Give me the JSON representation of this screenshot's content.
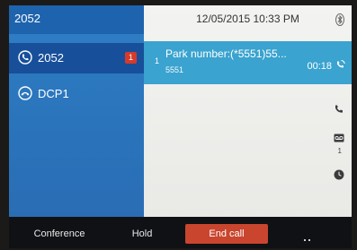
{
  "line_panel": {
    "header_label": "2052",
    "lines": [
      {
        "label": "2052",
        "badge": "1",
        "icon": "phone-active-icon"
      },
      {
        "label": "DCP1",
        "icon": "phone-handset-icon"
      }
    ]
  },
  "status_bar": {
    "datetime": "12/05/2015 10:33 PM",
    "bluetooth_icon": "bluetooth-icon"
  },
  "active_call": {
    "index": "1",
    "title": "Park number:(*5551)55...",
    "subtitle": "5551",
    "timer": "00:18",
    "status_icon": "call-connected-icon"
  },
  "side_icons": {
    "phone_icon": "phone-icon",
    "voicemail_icon": "voicemail-icon",
    "voicemail_count": "1",
    "history_icon": "clock-icon"
  },
  "softkeys": {
    "conference": "Conference",
    "hold": "Hold",
    "end_call": "End call",
    "more_icon": "more-dots-icon"
  },
  "colors": {
    "left_pane": "#2f7fc6",
    "active_line": "#174f9b",
    "call_bar": "#3aa3cf",
    "end_call": "#c9452e",
    "badge": "#d63a2b"
  }
}
